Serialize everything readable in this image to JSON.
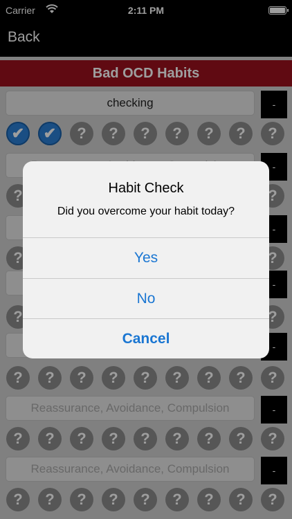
{
  "status": {
    "carrier": "Carrier",
    "time": "2:11 PM"
  },
  "nav": {
    "back_label": "Back"
  },
  "header": {
    "title": "Bad OCD Habits"
  },
  "habits": [
    {
      "text": "checking",
      "placeholder": false
    },
    {
      "text": "Reassurance, Avoidance, Compulsion",
      "placeholder": true
    },
    {
      "text": "Reassurance, Avoidance, Compulsion",
      "placeholder": true
    }
  ],
  "row_button_label": "-",
  "check_symbol": "✔",
  "unknown_symbol": "?",
  "dialog": {
    "title": "Habit Check",
    "message": "Did you overcome your habit today?",
    "yes_label": "Yes",
    "no_label": "No",
    "cancel_label": "Cancel"
  },
  "colors": {
    "title_bar": "#9b111e",
    "accent": "#1a76d2",
    "checked": "#2b7fd3"
  }
}
